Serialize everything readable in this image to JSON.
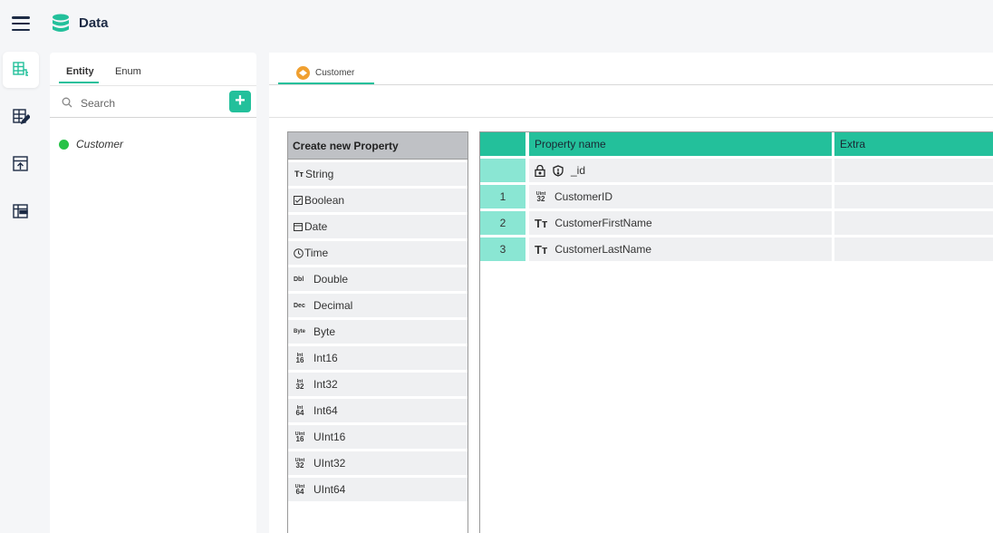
{
  "app": {
    "title": "Data"
  },
  "panel": {
    "tabs": [
      {
        "label": "Entity"
      },
      {
        "label": "Enum"
      }
    ],
    "search": {
      "placeholder": "Search"
    },
    "add_label": "+",
    "entities": [
      {
        "label": "Customer",
        "status_color": "#27c247"
      }
    ]
  },
  "editor": {
    "open_tab": {
      "label": "Customer"
    },
    "create": {
      "header": "Create new Property",
      "types": [
        {
          "icon": "TT",
          "label": "String"
        },
        {
          "icon": "checkbox-icon",
          "label": "Boolean"
        },
        {
          "icon": "calendar-icon",
          "label": "Date"
        },
        {
          "icon": "clock-icon",
          "label": "Time"
        },
        {
          "icon": "Dbl",
          "label": "Double"
        },
        {
          "icon": "Dec",
          "label": "Decimal"
        },
        {
          "icon": "Byte",
          "label": "Byte"
        },
        {
          "icon_top": "Int",
          "icon_bot": "16",
          "label": "Int16"
        },
        {
          "icon_top": "Int",
          "icon_bot": "32",
          "label": "Int32"
        },
        {
          "icon_top": "Int",
          "icon_bot": "64",
          "label": "Int64"
        },
        {
          "icon_top": "Uint",
          "icon_bot": "16",
          "label": "UInt16"
        },
        {
          "icon_top": "Uint",
          "icon_bot": "32",
          "label": "UInt32"
        },
        {
          "icon_top": "Uint",
          "icon_bot": "64",
          "label": "UInt64"
        }
      ]
    },
    "table": {
      "headers": {
        "index": "",
        "name": "Property name",
        "extra": "Extra"
      },
      "rows": [
        {
          "index": "",
          "icon": "lock-shield-icon",
          "name": "_id",
          "extra": ""
        },
        {
          "index": "1",
          "icon_top": "Uint",
          "icon_bot": "32",
          "name": "CustomerID",
          "extra": ""
        },
        {
          "index": "2",
          "icon": "TT",
          "name": "CustomerFirstName",
          "extra": ""
        },
        {
          "index": "3",
          "icon": "TT",
          "name": "CustomerLastName",
          "extra": ""
        }
      ]
    }
  },
  "colors": {
    "accent": "#23c09b",
    "index_cell": "#8ae6d3",
    "row_bg": "#eff0f2",
    "header_bg": "#bfc1c5"
  }
}
